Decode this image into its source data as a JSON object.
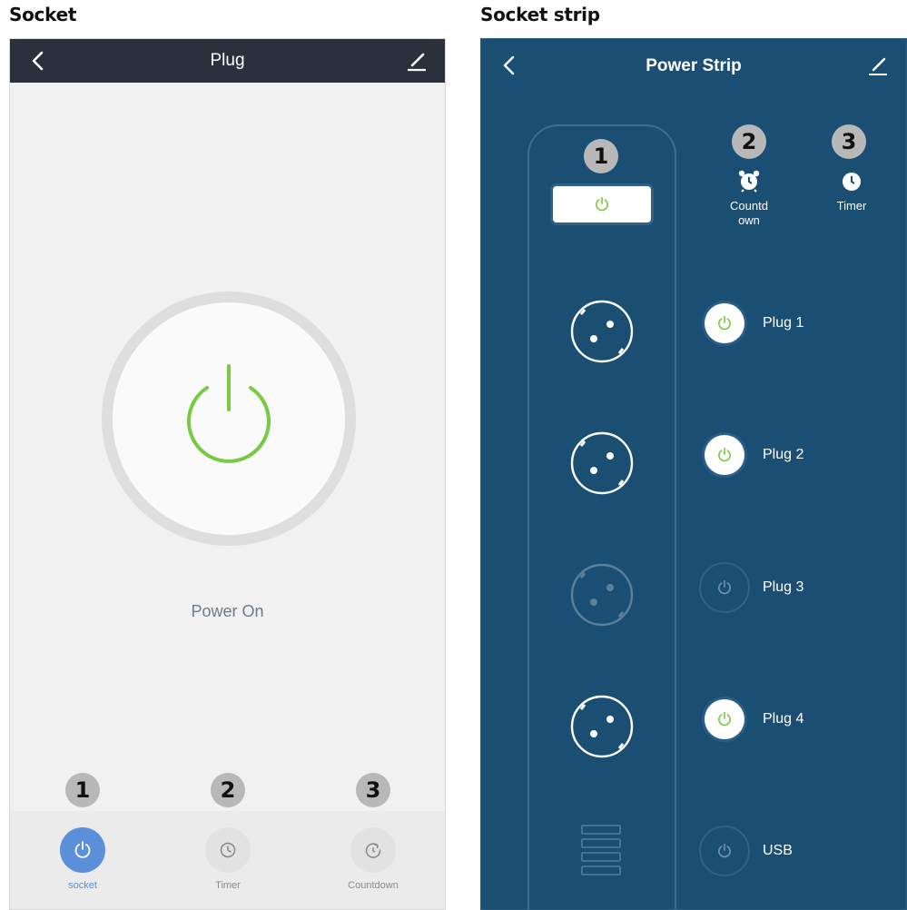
{
  "labels": {
    "left_section": "Socket",
    "right_section": "Socket strip"
  },
  "socket_app": {
    "header": {
      "title": "Plug",
      "back_icon": "chevron-left-icon",
      "edit_icon": "pencil-icon"
    },
    "power_button": {
      "icon": "power-icon",
      "state_color": "#7ac943"
    },
    "status": "Power On",
    "tabs": [
      {
        "label": "socket",
        "icon": "power-icon",
        "active": true,
        "badge": "1"
      },
      {
        "label": "Timer",
        "icon": "clock-icon",
        "active": false,
        "badge": "2"
      },
      {
        "label": "Countdown",
        "icon": "countdown-icon",
        "active": false,
        "badge": "3"
      }
    ],
    "colors": {
      "header_bg": "#2b313c",
      "accent": "#5b8fd9",
      "background": "#f1f1f1"
    }
  },
  "strip_app": {
    "header": {
      "title": "Power Strip",
      "back_icon": "chevron-left-icon",
      "edit_icon": "pencil-icon"
    },
    "badges": [
      "1",
      "2",
      "3"
    ],
    "actions": [
      {
        "label_line1": "Countd",
        "label_line2": "own",
        "icon": "alarm-clock-icon"
      },
      {
        "label_line1": "Timer",
        "icon": "clock-icon"
      }
    ],
    "plugs": [
      {
        "label": "Plug 1",
        "on": true
      },
      {
        "label": "Plug 2",
        "on": true
      },
      {
        "label": "Plug 3",
        "on": false
      },
      {
        "label": "Plug 4",
        "on": true
      },
      {
        "label": "USB",
        "on": false
      }
    ],
    "colors": {
      "background": "#1a4f73",
      "on_green": "#7ac943"
    }
  }
}
